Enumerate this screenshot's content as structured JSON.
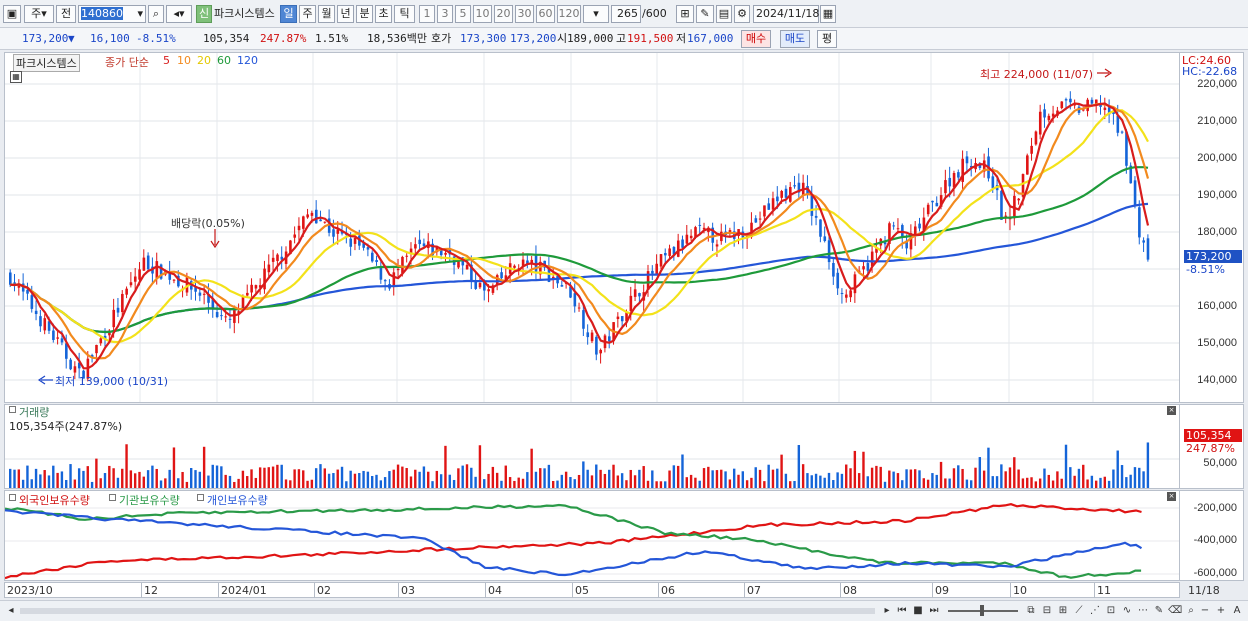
{
  "toolbar": {
    "market_type": "주",
    "range": "전",
    "code": "140860",
    "badge_new": "신",
    "stock_name": "파크시스템스",
    "periods": [
      "일",
      "주",
      "월",
      "년",
      "분",
      "초",
      "틱"
    ],
    "active_period": "일",
    "counts": [
      "1",
      "3",
      "5",
      "10",
      "20",
      "30",
      "60",
      "120"
    ],
    "view_count": "265",
    "view_total": "/600",
    "date": "2024/11/18"
  },
  "quote": {
    "price": "173,200",
    "change_arrow": "▼",
    "change": "16,100",
    "change_pct": "-8.51%",
    "volume": "105,354",
    "volume_ratio": "247.87%",
    "turnover_pct": "1.51%",
    "trade_value": "18,536백만",
    "ask_label": "호가",
    "ask": "173,300",
    "bid": "173,200",
    "open_label": "시",
    "open": "189,000",
    "high_label": "고",
    "high": "191,500",
    "low_label": "저",
    "low": "167,000",
    "buy_label": "매수",
    "sell_label": "매도",
    "flat_label": "평"
  },
  "price_panel": {
    "legend_name": "파크시스템스",
    "legend_type": "종가 단순",
    "ma_periods": [
      "5",
      "10",
      "20",
      "60",
      "120"
    ],
    "ma_colors": [
      "#d81c1c",
      "#f28a1e",
      "#f3e21a",
      "#1e9a3a",
      "#2456d8"
    ],
    "lc": "LC:24.60",
    "hc": "HC:-22.68",
    "high_note": "최고 224,000 (11/07)",
    "low_note": "최저 139,000 (10/31)",
    "dividend_note": "배당락(0.05%)",
    "current_price": "173,200",
    "current_pct": "-8.51%",
    "y_ticks": [
      "220,000",
      "210,000",
      "200,000",
      "190,000",
      "180,000",
      "170,000",
      "160,000",
      "150,000",
      "140,000"
    ],
    "up_color": "#e01414",
    "down_color": "#1464d8"
  },
  "volume_panel": {
    "title": "거래량",
    "subtitle": "105,354주(247.87%)",
    "current": "105,354",
    "current_pct": "247.87%",
    "y_tick": "50,000"
  },
  "holding_panel": {
    "series": [
      "외국인보유수량",
      "기관보유수량",
      "개인보유수량"
    ],
    "colors": [
      "#e01414",
      "#2a9a48",
      "#2456d8"
    ],
    "y_ticks": [
      "-200,000",
      "-400,000",
      "-600,000"
    ]
  },
  "x_axis": [
    "2023/10",
    "12",
    "2024/01",
    "02",
    "03",
    "04",
    "05",
    "06",
    "07",
    "08",
    "09",
    "10",
    "11",
    "11/18"
  ]
}
